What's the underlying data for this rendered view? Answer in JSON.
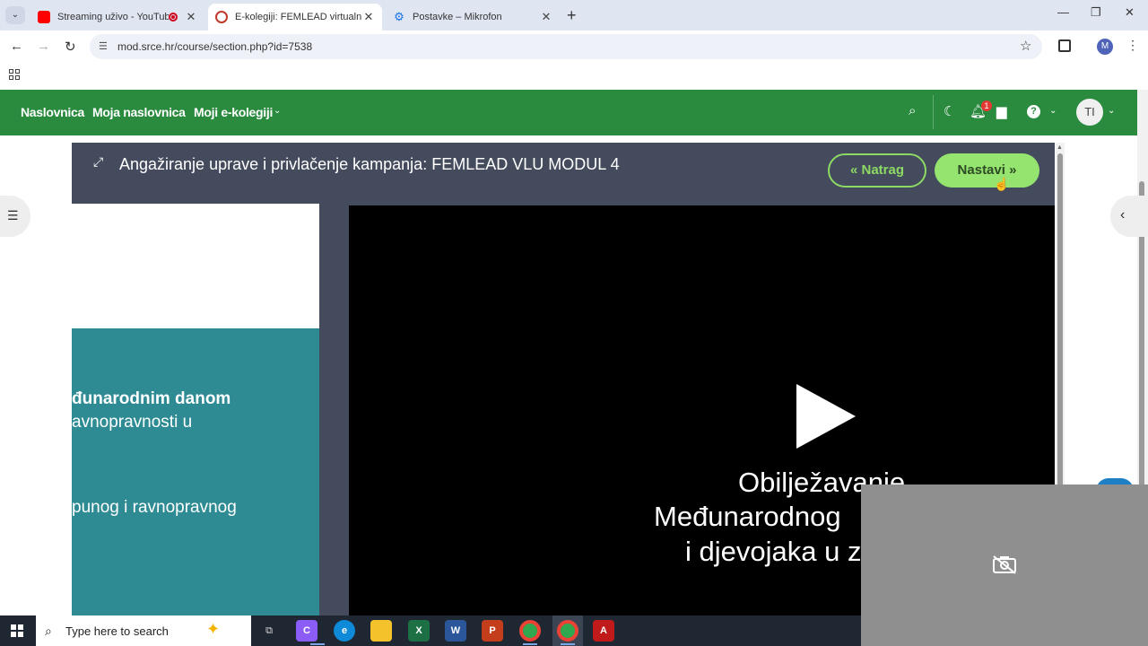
{
  "browser": {
    "tabs": [
      {
        "title": "Streaming uživo - YouTube",
        "active": false,
        "favicon_color": "#ff0000"
      },
      {
        "title": "E-kolegiji: FEMLEAD virtualni lab",
        "active": true,
        "favicon_color": "#c0392b"
      },
      {
        "title": "Postavke – Mikrofon",
        "active": false,
        "favicon_color": "#1a73e8"
      }
    ],
    "url": "mod.srce.hr/course/section.php?id=7538",
    "profile_initial": "M"
  },
  "moodle": {
    "nav": [
      "Naslovnica",
      "Moja naslovnica",
      "Moji e-kolegiji"
    ],
    "notification_count": "1",
    "user_initials": "TI",
    "brand_color": "#2a8b3f"
  },
  "activity": {
    "title": "Angažiranje uprave i privlačenje kampanja: FEMLEAD VLU MODUL 4",
    "back_label": "Natrag",
    "next_label": "Nastavi"
  },
  "slide": {
    "line1": "đunarodnim danom",
    "line2": "avnopravnosti u",
    "line3": "punog i ravnopravnog"
  },
  "video": {
    "lines": [
      "Obilježavanje",
      "Međunarodnog",
      "i djevojaka u z"
    ]
  },
  "taskbar": {
    "search_placeholder": "Type here to search",
    "apps": [
      "task-view",
      "copilot",
      "edge",
      "file-explorer",
      "excel",
      "word",
      "powerpoint",
      "chrome",
      "chrome",
      "acrobat"
    ]
  }
}
